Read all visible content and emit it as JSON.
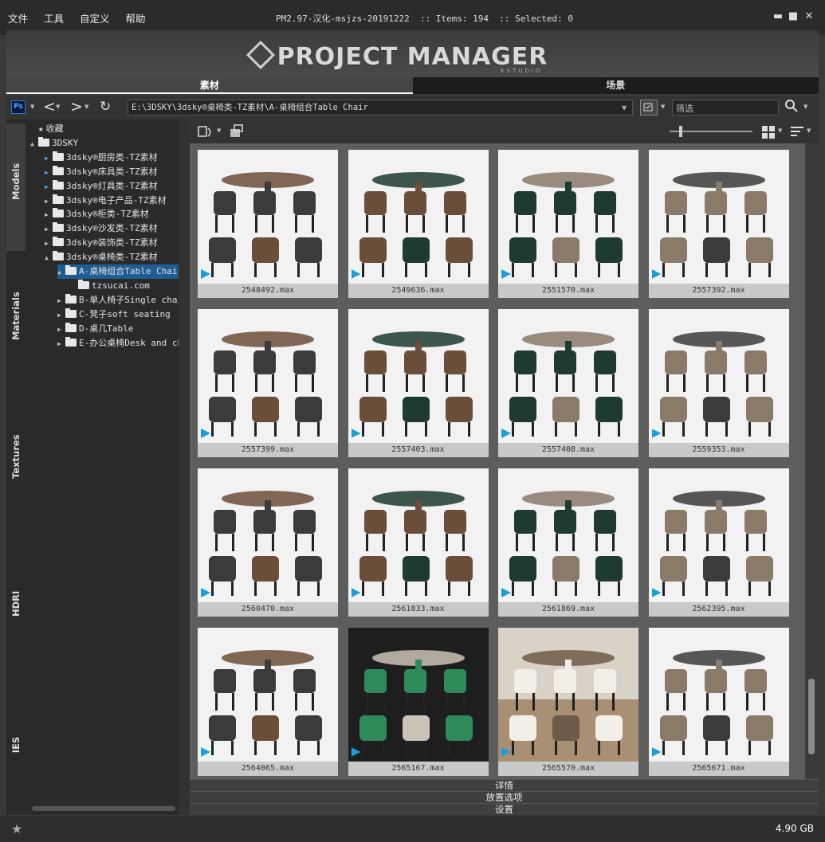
{
  "menu": [
    "文件",
    "工具",
    "自定义",
    "帮助"
  ],
  "window": {
    "title": "PM2.97-汉化-msjzs-20191222  :: Items: 194  :: Selected: 0",
    "minimize": "▬",
    "maximize": "■",
    "close": "✕"
  },
  "banner": {
    "logo": "PROJECT MANAGER",
    "sub": "KSTUDIO"
  },
  "tabs": [
    {
      "label": "素材",
      "active": true
    },
    {
      "label": "场景",
      "active": false
    }
  ],
  "address": {
    "path": "E:\\3DSKY\\3dsky®桌椅类-TZ素材\\A-桌椅组合Table Chair",
    "filter_placeholder": "筛选"
  },
  "sidetabs": [
    "Models",
    "Materials",
    "Textures",
    "HDRI",
    "IES"
  ],
  "tree": [
    {
      "label": "收藏",
      "level": 0,
      "caret": "",
      "icon": "star"
    },
    {
      "label": "3DSKY",
      "level": 0,
      "caret": "▲"
    },
    {
      "label": "3dsky®厨房类-TZ素材",
      "level": 1,
      "caret": "▶",
      "exp": true
    },
    {
      "label": "3dsky®床具类-TZ素材",
      "level": 1,
      "caret": "▶",
      "exp": true
    },
    {
      "label": "3dsky®灯具类-TZ素材",
      "level": 1,
      "caret": "▶",
      "exp": true
    },
    {
      "label": "3dsky®电子产品-TZ素材",
      "level": 1,
      "caret": "▶"
    },
    {
      "label": "3dsky®柜类-TZ素材",
      "level": 1,
      "caret": "▶"
    },
    {
      "label": "3dsky®沙发类-TZ素材",
      "level": 1,
      "caret": "▶"
    },
    {
      "label": "3dsky®装饰类-TZ素材",
      "level": 1,
      "caret": "▶"
    },
    {
      "label": "3dsky®桌椅类-TZ素材",
      "level": 1,
      "caret": "▲"
    },
    {
      "label": "A-桌椅组合Table Chair",
      "level": 2,
      "caret": "▲",
      "sel": true
    },
    {
      "label": "tzsucai.com",
      "level": 3,
      "caret": ""
    },
    {
      "label": "B-单人椅子Single chair",
      "level": 2,
      "caret": "▶"
    },
    {
      "label": "C-凳子soft seating",
      "level": 2,
      "caret": "▶"
    },
    {
      "label": "D-桌几Table",
      "level": 2,
      "caret": "▶"
    },
    {
      "label": "E-办公桌椅Desk and chair",
      "level": 2,
      "caret": "▶"
    }
  ],
  "items": [
    {
      "name": "2548492.max",
      "style": "light"
    },
    {
      "name": "2549636.max",
      "style": "light"
    },
    {
      "name": "2551570.max",
      "style": "light"
    },
    {
      "name": "2557392.max",
      "style": "light"
    },
    {
      "name": "2557399.max",
      "style": "light"
    },
    {
      "name": "2557403.max",
      "style": "light"
    },
    {
      "name": "2557408.max",
      "style": "light"
    },
    {
      "name": "2559353.max",
      "style": "light"
    },
    {
      "name": "2560470.max",
      "style": "light"
    },
    {
      "name": "2561833.max",
      "style": "light"
    },
    {
      "name": "2561869.max",
      "style": "light"
    },
    {
      "name": "2562395.max",
      "style": "light"
    },
    {
      "name": "2564065.max",
      "style": "light"
    },
    {
      "name": "2565167.max",
      "style": "dark"
    },
    {
      "name": "2565570.max",
      "style": "room"
    },
    {
      "name": "2565671.max",
      "style": "light"
    }
  ],
  "panels": [
    "详情",
    "放置选项",
    "设置"
  ],
  "status": {
    "disk": "4.90 GB"
  },
  "colors": {
    "selection": "#1f5c94",
    "accent": "#1c9ed8"
  }
}
